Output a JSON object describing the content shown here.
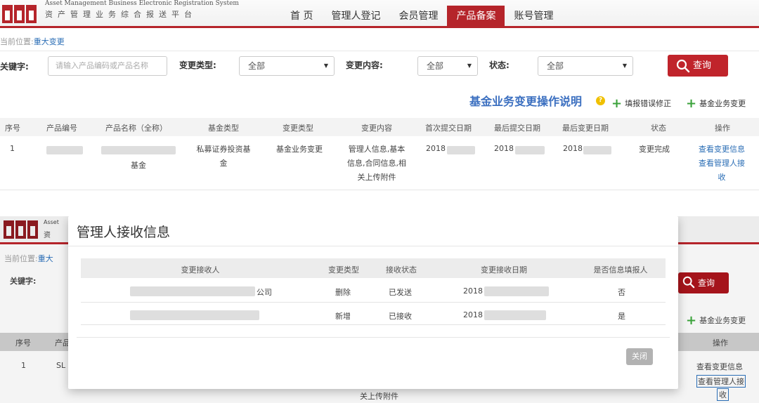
{
  "header": {
    "brand_en": "Asset Management Business Electronic Registration System",
    "brand_cn": "资产管理业务综合报送平台",
    "nav": [
      {
        "label": "首 页",
        "active": false
      },
      {
        "label": "管理人登记",
        "active": false
      },
      {
        "label": "会员管理",
        "active": false
      },
      {
        "label": "产品备案",
        "active": true
      },
      {
        "label": "账号管理",
        "active": false
      }
    ]
  },
  "breadcrumb": {
    "prefix": "当前位置:",
    "current": "重大变更"
  },
  "filters": {
    "keyword_label": "关键字:",
    "keyword_placeholder": "请输入产品编码或产品名称",
    "change_type_label": "变更类型:",
    "change_type_value": "全部",
    "change_content_label": "变更内容:",
    "change_content_value": "全部",
    "status_label": "状态:",
    "status_value": "全部",
    "search_button": "查询"
  },
  "actions": {
    "help_title": "基金业务变更操作说明",
    "help_badge": "?",
    "fix_error": "填报错误修正",
    "fund_change": "基金业务变更"
  },
  "table": {
    "headers": [
      "序号",
      "产品编号",
      "产品名称（全称）",
      "基金类型",
      "变更类型",
      "变更内容",
      "首次提交日期",
      "最后提交日期",
      "最后变更日期",
      "状态",
      "操作"
    ],
    "row": {
      "index": "1",
      "name_suffix": "基金",
      "fund_type_line1": "私募证券投资基",
      "fund_type_line2": "金",
      "change_type": "基金业务变更",
      "content_line1": "管理人信息,基本",
      "content_line2": "信息,合同信息,相",
      "content_line3": "关上传附件",
      "first_submit": "2018",
      "last_submit": "2018",
      "last_change": "2018",
      "status": "变更完成",
      "op_view_change": "查看变更信息",
      "op_view_manager_line1": "查看管理人接",
      "op_view_manager_line2": "收"
    }
  },
  "background": {
    "brand_en": "Asset",
    "brand_cn": "资",
    "breadcrumb_prefix": "当前位置:",
    "breadcrumb_current": "重大",
    "keyword_label": "关键字:",
    "search_button": "查询",
    "fund_change": "基金业务变更",
    "col_index": "序号",
    "col_product": "产品",
    "col_op": "操作",
    "row_index": "1",
    "row_code": "SL",
    "row_content": "关上传附件",
    "op_view_change": "查看变更信息",
    "op_view_manager": "查看管理人接",
    "op_view_manager_line2": "收"
  },
  "modal": {
    "title": "管理人接收信息",
    "headers": [
      "变更接收人",
      "变更类型",
      "接收状态",
      "变更接收日期",
      "是否信息填报人"
    ],
    "rows": [
      {
        "receiver_suffix": "公司",
        "type": "删除",
        "status": "已发送",
        "date": "2018",
        "is_filer": "否"
      },
      {
        "receiver_suffix": "",
        "type": "新增",
        "status": "已接收",
        "date": "2018",
        "is_filer": "是"
      }
    ],
    "close_button": "关闭"
  },
  "colors": {
    "brand_red": "#b5242a",
    "link_blue": "#2a6db5",
    "plus_green": "#3aa23a",
    "help_blue": "#3b6fc0"
  }
}
